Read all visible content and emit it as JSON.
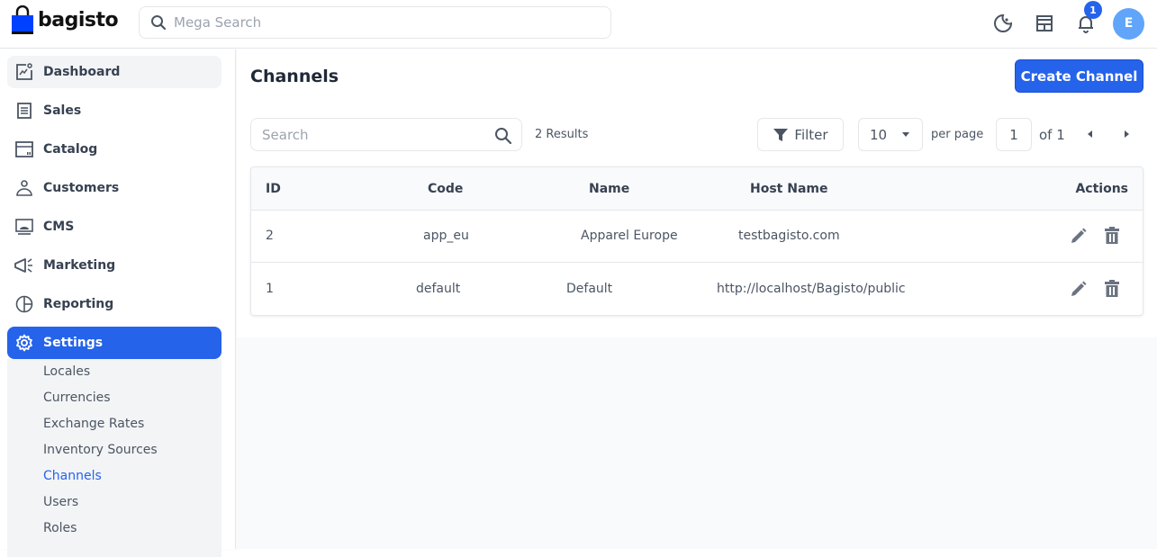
{
  "app": {
    "brand": "bagisto",
    "brand_color": "#0041ff",
    "accent_color": "#2563eb"
  },
  "header": {
    "search_placeholder": "Mega Search",
    "icons": [
      "dark-mode-icon",
      "storefront-icon",
      "bell-icon"
    ],
    "notification_count": "1",
    "avatar_initial": "E"
  },
  "sidebar": {
    "items": [
      {
        "label": "Dashboard",
        "icon": "dashboard-icon"
      },
      {
        "label": "Sales",
        "icon": "sales-icon"
      },
      {
        "label": "Catalog",
        "icon": "catalog-icon"
      },
      {
        "label": "Customers",
        "icon": "customers-icon"
      },
      {
        "label": "CMS",
        "icon": "cms-icon"
      },
      {
        "label": "Marketing",
        "icon": "marketing-icon"
      },
      {
        "label": "Reporting",
        "icon": "reporting-icon"
      },
      {
        "label": "Settings",
        "icon": "settings-icon",
        "active": true
      }
    ],
    "settings_submenu": [
      {
        "label": "Locales"
      },
      {
        "label": "Currencies"
      },
      {
        "label": "Exchange Rates"
      },
      {
        "label": "Inventory Sources"
      },
      {
        "label": "Channels",
        "current": true
      },
      {
        "label": "Users"
      },
      {
        "label": "Roles"
      }
    ]
  },
  "main": {
    "title": "Channels",
    "create_button": "Create Channel",
    "search_placeholder": "Search",
    "results": "2 Results",
    "filter_label": "Filter",
    "per_page_value": "10",
    "per_page_label": "per page",
    "current_page": "1",
    "page_of": "of 1",
    "table": {
      "columns": [
        "ID",
        "Code",
        "Name",
        "Host Name",
        "Actions"
      ],
      "rows": [
        {
          "id": "2",
          "code": "app_eu",
          "name": "Apparel Europe",
          "host": "testbagisto.com"
        },
        {
          "id": "1",
          "code": "default",
          "name": "Default",
          "host": "http://localhost/Bagisto/public"
        }
      ]
    }
  }
}
